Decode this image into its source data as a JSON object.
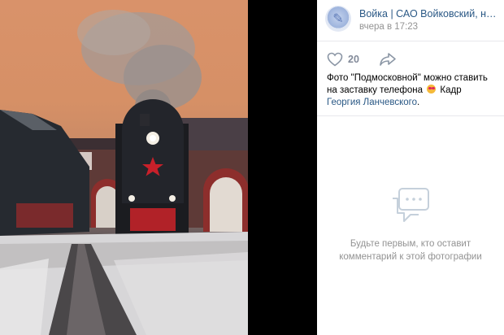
{
  "post": {
    "author": "Войка | САО Войковский, наденьте маску",
    "date": "вчера в 17:23",
    "likes": "20",
    "caption_part1": "Фото \"Подмосковной\" можно ставить на заставку телефона",
    "caption_part2": " Кадр ",
    "caption_link": "Георгия Ланчевского",
    "caption_end": "."
  },
  "comments": {
    "empty_text": "Будьте первым, кто оставит комментарий к этой фотографии"
  },
  "icons": {
    "avatar": "community-avatar",
    "like": "heart-icon",
    "share": "share-arrow-icon",
    "emoji": "heart-eyes-emoji",
    "empty": "comments-bubble-icon"
  },
  "colors": {
    "link": "#2a5885",
    "muted": "#939393",
    "locomotive_star": "#c8202a"
  }
}
